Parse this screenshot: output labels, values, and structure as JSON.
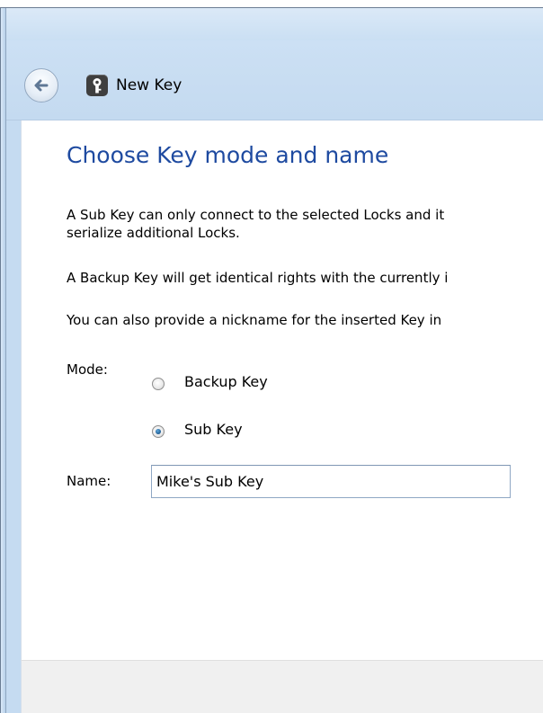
{
  "window": {
    "title": "New Key"
  },
  "content": {
    "heading": "Choose Key mode and name",
    "paragraphs": [
      "A Sub Key can only connect to the selected Locks and it",
      "serialize additional Locks.",
      "A Backup Key will get identical rights with the currently i",
      "You can also provide a nickname for the inserted Key in"
    ]
  },
  "mode": {
    "label": "Mode:",
    "options": [
      {
        "label": "Backup Key",
        "selected": false
      },
      {
        "label": "Sub Key",
        "selected": true
      }
    ]
  },
  "name": {
    "label": "Name:",
    "value": "Mike's Sub Key"
  },
  "colors": {
    "heading": "#1e4aa0",
    "nav_bg": "#c4daf0",
    "footer_bg": "#f0f0f0"
  },
  "icons": {
    "back": "back-arrow-icon",
    "app": "key-icon"
  }
}
